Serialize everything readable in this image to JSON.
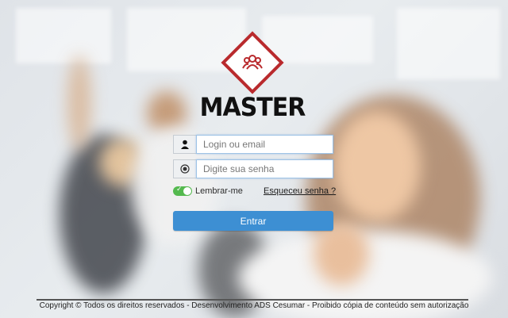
{
  "brand": {
    "name": "MASTER",
    "logo_icon": "users-group-icon",
    "logo_color": "#b92a2d"
  },
  "login": {
    "user_placeholder": "Login ou email",
    "user_icon": "user-icon",
    "password_placeholder": "Digite sua senha",
    "password_icon": "radio-dot-icon"
  },
  "remember": {
    "label": "Lembrar-me",
    "checked": true,
    "toggle_color": "#54b94e"
  },
  "forgot_link": "Esqueceu senha ?",
  "submit_label": "Entrar",
  "submit_color": "#3d8fd3",
  "footer": "Copyright © Todos os direitos reservados - Desenvolvimento ADS Cesumar - Proibido cópia de conteúdo sem autorização"
}
